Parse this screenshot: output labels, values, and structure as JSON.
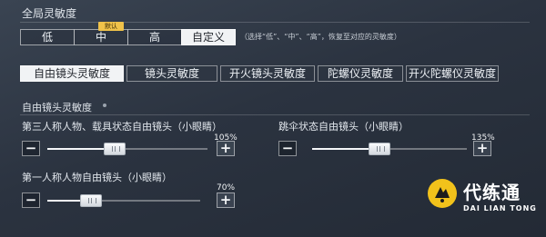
{
  "header": {
    "title": "全局灵敏度"
  },
  "presets": {
    "options": [
      "低",
      "中",
      "高",
      "自定义"
    ],
    "selected": "自定义",
    "default_badge": "默认",
    "note": "（选择“低”、“中”、“高”，恢复至对应的灵敏度）"
  },
  "tabs": [
    "自由镜头灵敏度",
    "镜头灵敏度",
    "开火镜头灵敏度",
    "陀螺仪灵敏度",
    "开火陀螺仪灵敏度"
  ],
  "active_tab": "自由镜头灵敏度",
  "section": {
    "title": "自由镜头灵敏度"
  },
  "sliders": [
    {
      "label": "第三人称人物、载具状态自由镜头（小眼睛）",
      "value_label": "105%",
      "value": 105
    },
    {
      "label": "跳伞状态自由镜头（小眼睛）",
      "value_label": "135%",
      "value": 135
    },
    {
      "label": "第一人称人物自由镜头（小眼睛）",
      "value_label": "70%",
      "value": 70
    }
  ],
  "watermark": {
    "title": "代练通",
    "subtitle": "DAI LIAN TONG"
  },
  "colors": {
    "accent": "#f0c24a",
    "selected_bg": "#f1f3f5",
    "watermark_bg": "#1c1c1c"
  }
}
